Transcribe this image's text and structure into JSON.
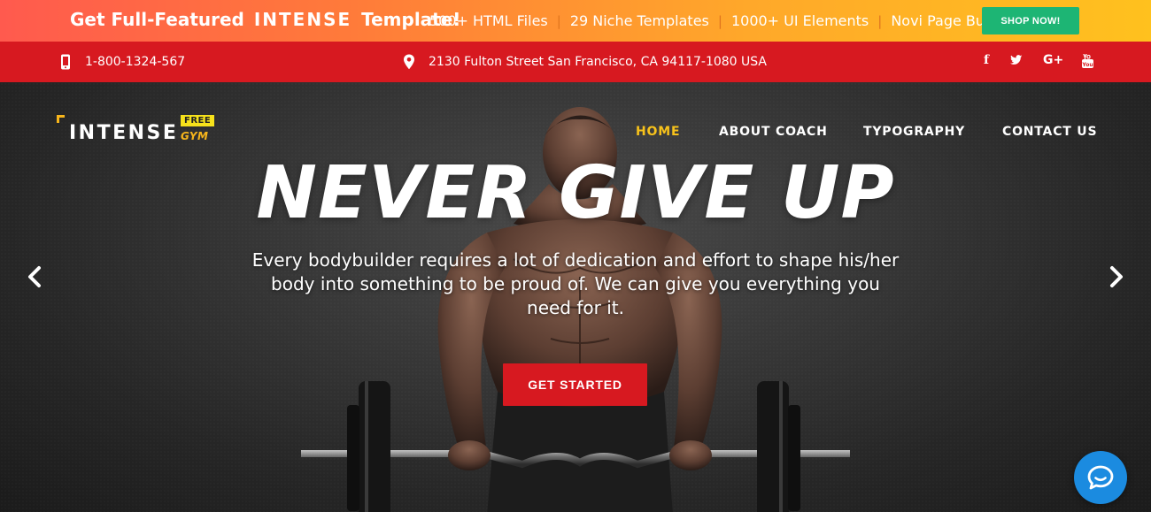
{
  "promo": {
    "title_prefix": "Get Full-Featured",
    "title_brand": "INTENSE",
    "title_suffix": "Template!",
    "features": [
      "500+ HTML Files",
      "29 Niche Templates",
      "1000+ UI Elements",
      "Novi Page Builder"
    ],
    "separator": "|",
    "shop_button": "SHOP NOW!",
    "colors": {
      "shop_button": "#1db574",
      "gradient_start": "#ff5a4e",
      "gradient_end": "#ffc11e"
    }
  },
  "infobar": {
    "phone": "1-800-1324-567",
    "address": "2130 Fulton Street San Francisco, CA 94117-1080 USA",
    "phone_icon": "mobile-phone-icon",
    "address_icon": "map-pin-icon",
    "social": [
      {
        "icon": "facebook-icon",
        "glyph": "f"
      },
      {
        "icon": "twitter-icon",
        "glyph": "t"
      },
      {
        "icon": "google-plus-icon",
        "glyph": "G+"
      },
      {
        "icon": "youtube-icon",
        "glyph": "▶"
      }
    ],
    "background": "#d71920"
  },
  "logo": {
    "text": "INTENSE",
    "badge": "FREE",
    "sub": "GYM"
  },
  "nav": {
    "items": [
      "HOME",
      "ABOUT COACH",
      "TYPOGRAPHY",
      "CONTACT US"
    ],
    "active": "HOME",
    "active_color": "#f7c21b"
  },
  "hero": {
    "headline": "NEVER GIVE UP",
    "subtext": "Every bodybuilder requires a lot of dedication and effort to shape his/her body into something to be proud of. We can give you everything you need for it.",
    "cta": "GET STARTED",
    "prev_icon": "chevron-left-icon",
    "next_icon": "chevron-right-icon"
  },
  "chat": {
    "icon": "chat-bubble-icon",
    "color": "#1b8be0"
  }
}
